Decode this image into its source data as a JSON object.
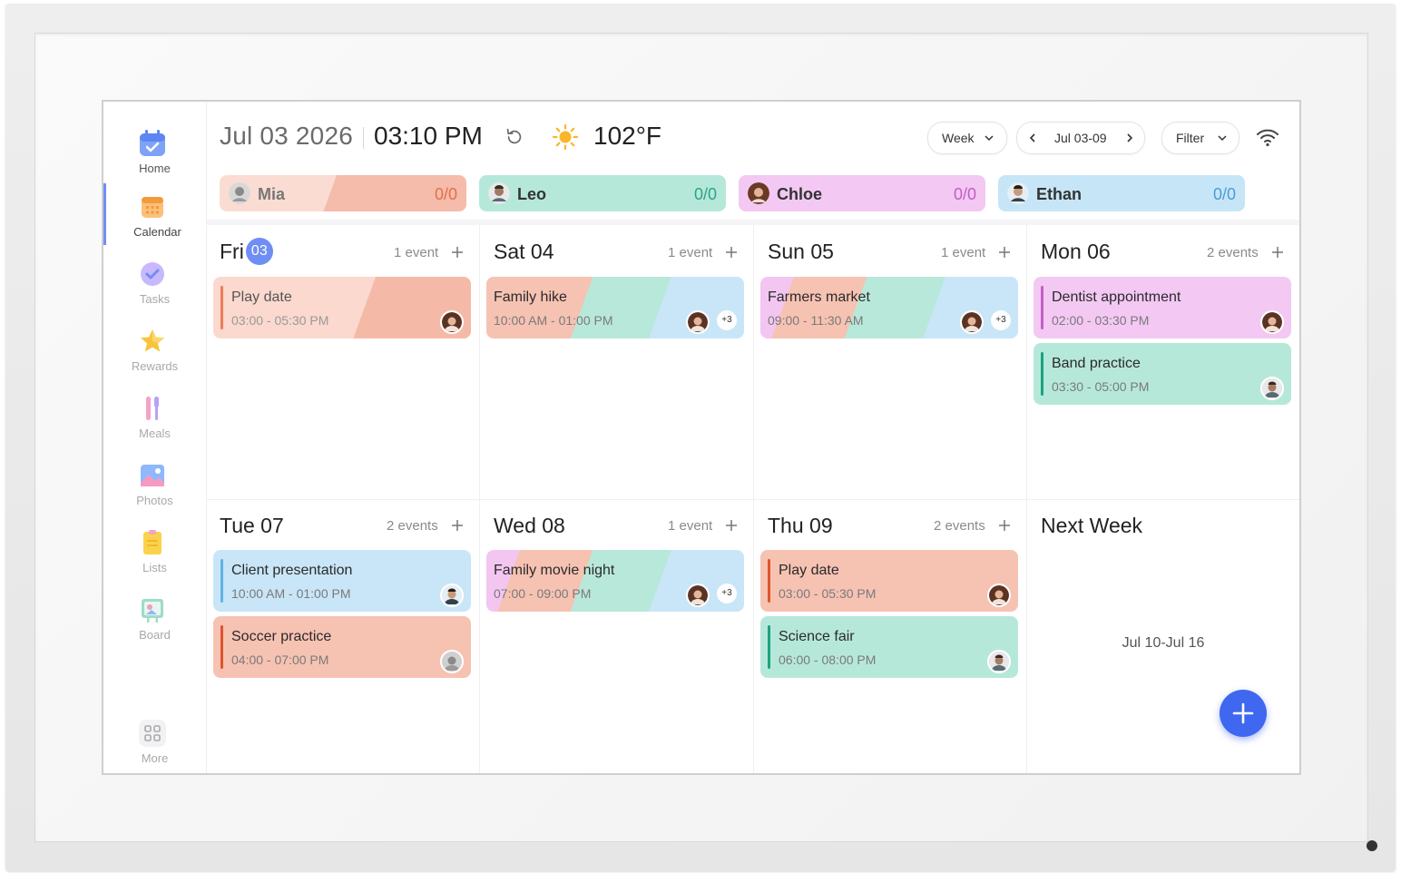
{
  "header": {
    "date": "Jul 03 2026",
    "time": "03:10 PM",
    "temperature": "102°F",
    "view_mode": "Week",
    "range": "Jul 03-09",
    "filter_label": "Filter"
  },
  "sidebar": {
    "items": [
      {
        "label": "Home",
        "icon": "calendar-check-icon"
      },
      {
        "label": "Calendar",
        "icon": "calendar-grid-icon"
      },
      {
        "label": "Tasks",
        "icon": "check-circle-icon"
      },
      {
        "label": "Rewards",
        "icon": "star-icon"
      },
      {
        "label": "Meals",
        "icon": "utensils-icon"
      },
      {
        "label": "Photos",
        "icon": "photo-icon"
      },
      {
        "label": "Lists",
        "icon": "notepad-icon"
      },
      {
        "label": "Board",
        "icon": "board-icon"
      },
      {
        "label": "More",
        "icon": "grid-icon"
      }
    ]
  },
  "people": [
    {
      "name": "Mia",
      "score": "0/0",
      "color": "#f7c6b6"
    },
    {
      "name": "Leo",
      "score": "0/0",
      "color": "#b6e8da"
    },
    {
      "name": "Chloe",
      "score": "0/0",
      "color": "#f3c8f3"
    },
    {
      "name": "Ethan",
      "score": "0/0",
      "color": "#c6e6f7"
    }
  ],
  "days": [
    {
      "title": "Fri",
      "badge": "03",
      "count": "1 event",
      "events": [
        {
          "title": "Play date",
          "time": "03:00 - 05:30 PM"
        }
      ]
    },
    {
      "title": "Sat 04",
      "count": "1 event",
      "events": [
        {
          "title": "Family hike",
          "time": "10:00 AM - 01:00 PM",
          "more": "+3"
        }
      ]
    },
    {
      "title": "Sun 05",
      "count": "1 event",
      "events": [
        {
          "title": "Farmers market",
          "time": "09:00 - 11:30 AM",
          "more": "+3"
        }
      ]
    },
    {
      "title": "Mon 06",
      "count": "2 events",
      "events": [
        {
          "title": "Dentist appointment",
          "time": "02:00 - 03:30 PM"
        },
        {
          "title": "Band practice",
          "time": "03:30 - 05:00 PM"
        }
      ]
    },
    {
      "title": "Tue 07",
      "count": "2 events",
      "events": [
        {
          "title": "Client presentation",
          "time": "10:00 AM - 01:00 PM"
        },
        {
          "title": "Soccer practice",
          "time": "04:00 - 07:00 PM"
        }
      ]
    },
    {
      "title": "Wed 08",
      "count": "1 event",
      "events": [
        {
          "title": "Family movie night",
          "time": "07:00 - 09:00 PM",
          "more": "+3"
        }
      ]
    },
    {
      "title": "Thu 09",
      "count": "2 events",
      "events": [
        {
          "title": "Play date",
          "time": "03:00 - 05:30 PM"
        },
        {
          "title": "Science fair",
          "time": "06:00 - 08:00 PM"
        }
      ]
    }
  ],
  "next_week": {
    "title": "Next Week",
    "range": "Jul 10-Jul 16"
  },
  "colors": {
    "accent": "#6f8ef5",
    "fab": "#3f67f0",
    "mia": "#f7c6b6",
    "leo": "#b6e8da",
    "chloe": "#f3c8f3",
    "ethan": "#c6e6f7"
  }
}
